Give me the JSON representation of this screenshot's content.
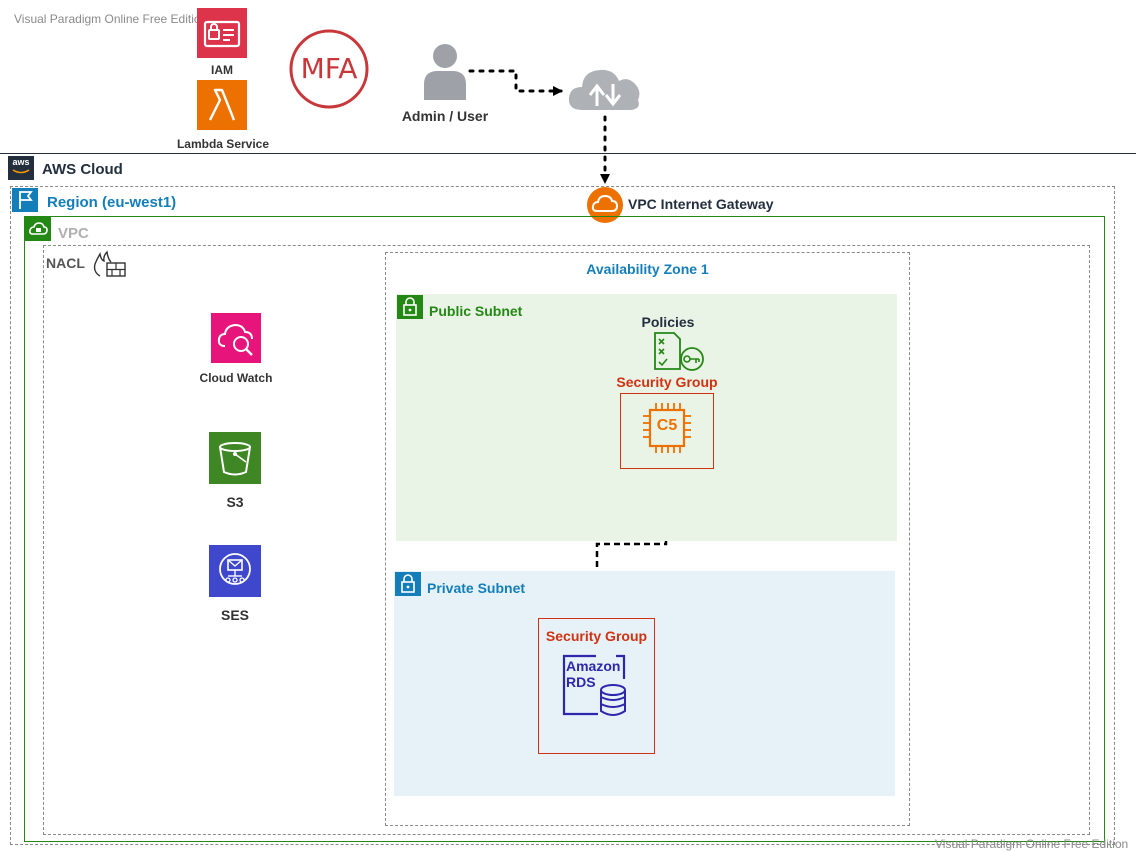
{
  "watermark": {
    "top": "Visual Paradigm Online Free Edition",
    "bottom": "Visual Paradigm Online Free Edition"
  },
  "top": {
    "iam_label": "IAM",
    "lambda_label": "Lambda Service",
    "mfa_text": "MFA",
    "user_label": "Admin / User"
  },
  "cloud": {
    "aws_logo": "aws",
    "label": "AWS Cloud"
  },
  "region": {
    "label": "Region (eu-west1)"
  },
  "igw": {
    "label": "VPC Internet Gateway"
  },
  "vpc": {
    "label": "VPC"
  },
  "nacl": {
    "label": "NACL"
  },
  "services": {
    "cloudwatch": "Cloud Watch",
    "s3": "S3",
    "ses": "SES"
  },
  "az": {
    "label": "Availability Zone 1"
  },
  "public_subnet": {
    "label": "Public Subnet",
    "policies": "Policies",
    "sg_label": "Security Group",
    "ec2_text": "C5"
  },
  "private_subnet": {
    "label": "Private Subnet",
    "sg_label": "Security Group",
    "rds_line1": "Amazon",
    "rds_line2": "RDS"
  },
  "colors": {
    "iam": "#dd344c",
    "lambda": "#ed7100",
    "mfa": "#c8383b",
    "region": "#147eba",
    "vpc": "#248814",
    "public_subnet_bg": "#e9f3e6",
    "private_subnet_bg": "#e6f2f8",
    "private_label": "#147eba",
    "security_group": "#d13212",
    "cloudwatch": "#e7157b",
    "s3": "#3f8624",
    "ses": "#3f48cc",
    "az": "#147eba",
    "rds": "#2e27ad"
  },
  "icons": [
    "iam-icon",
    "lambda-icon",
    "mfa-icon",
    "user-icon",
    "cloud-sync-icon",
    "aws-logo-icon",
    "region-flag-icon",
    "internet-gateway-icon",
    "vpc-icon",
    "firewall-icon",
    "cloudwatch-icon",
    "s3-bucket-icon",
    "ses-icon",
    "public-subnet-lock-icon",
    "policies-icon",
    "ec2-chip-icon",
    "private-subnet-lock-icon",
    "rds-icon"
  ]
}
